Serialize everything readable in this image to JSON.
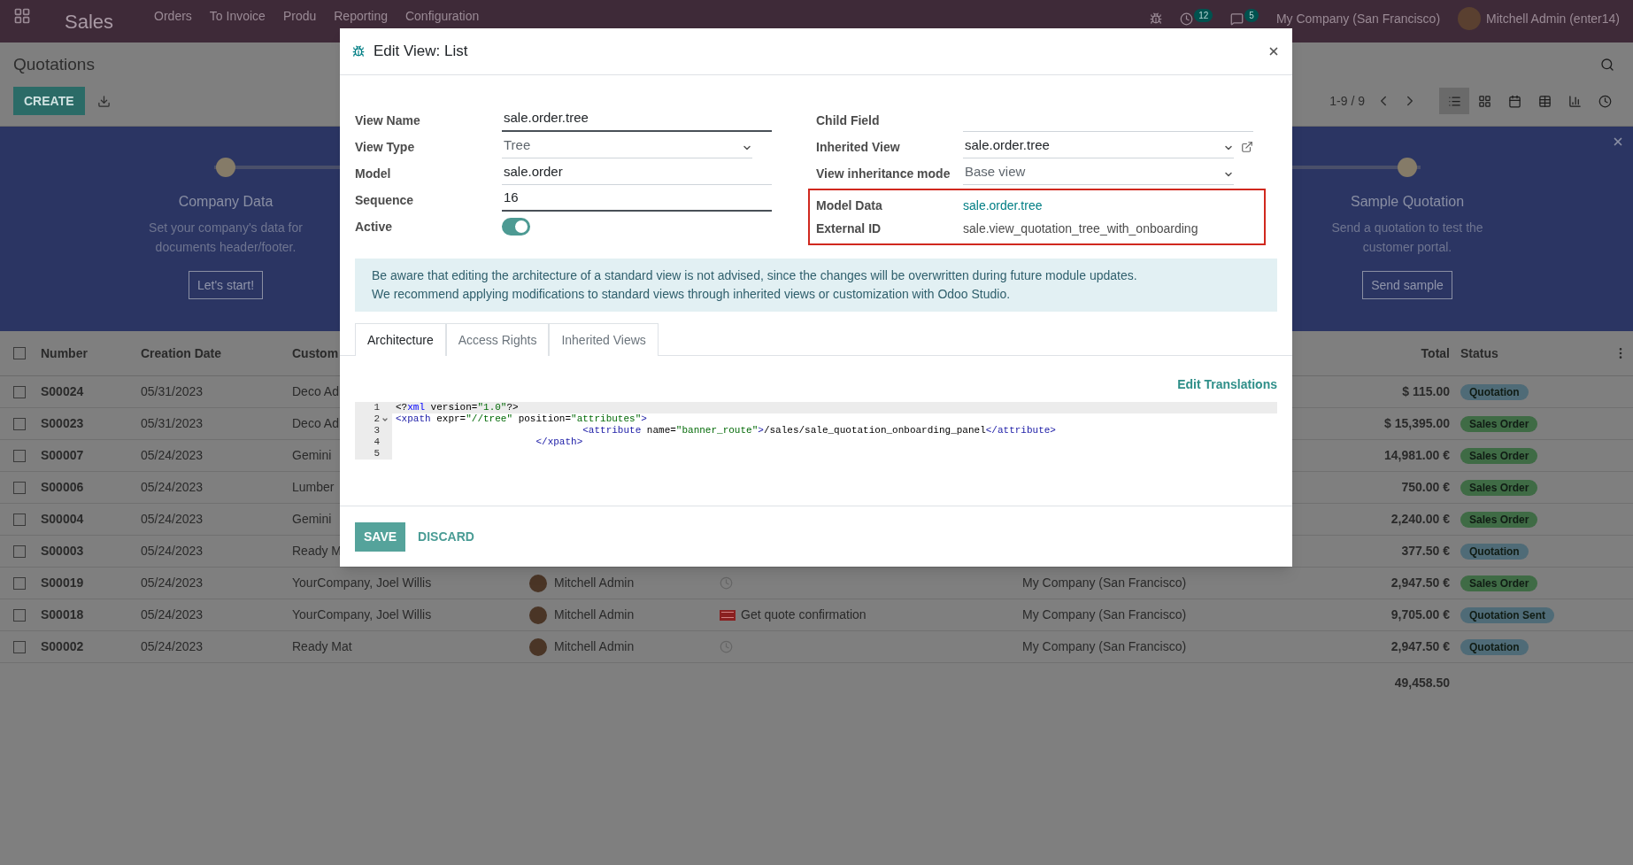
{
  "navbar": {
    "app": "Sales",
    "menu": [
      "Orders",
      "To Invoice",
      "Produ",
      "Reporting",
      "Configuration"
    ],
    "activity_count": "12",
    "message_count": "5",
    "company": "My Company (San Francisco)",
    "user": "Mitchell Admin (enter14)"
  },
  "control_panel": {
    "title": "Quotations",
    "create": "CREATE",
    "pager": "1-9 / 9",
    "views": [
      {
        "kind": "list",
        "selected": true
      },
      {
        "kind": "kanban",
        "selected": false
      },
      {
        "kind": "calendar",
        "selected": false
      },
      {
        "kind": "pivot",
        "selected": false
      },
      {
        "kind": "graph",
        "selected": false
      },
      {
        "kind": "activity",
        "selected": false
      }
    ]
  },
  "banner": {
    "steps": [
      {
        "title": "Company Data",
        "text": "Set your company's data for documents header/footer.",
        "button": "Let's start!"
      },
      {
        "title": "Sample Quotation",
        "text": "Send a quotation to test the customer portal.",
        "button": "Send sample"
      }
    ]
  },
  "table": {
    "columns": [
      "Number",
      "Creation Date",
      "Custom",
      "Total",
      "Status"
    ],
    "all_checked": false,
    "rows": [
      {
        "checked": false,
        "number": "S00024",
        "date": "05/31/2023",
        "customer": "Deco Ad",
        "total": "$ 115.00",
        "status": "Quotation",
        "color": "#4f6b77"
      },
      {
        "checked": false,
        "number": "S00023",
        "date": "05/31/2023",
        "customer": "Deco Ad",
        "total": "$ 15,395.00",
        "status": "Sales Order",
        "color": "#3f6b45"
      },
      {
        "checked": false,
        "number": "S00007",
        "date": "05/24/2023",
        "customer": "Gemini",
        "total": "14,981.00 €",
        "status": "Sales Order",
        "color": "#3f6b45"
      },
      {
        "checked": false,
        "number": "S00006",
        "date": "05/24/2023",
        "customer": "Lumber",
        "total": "750.00 €",
        "status": "Sales Order",
        "color": "#3f6b45"
      },
      {
        "checked": false,
        "number": "S00004",
        "date": "05/24/2023",
        "customer": "Gemini",
        "total": "2,240.00 €",
        "status": "Sales Order",
        "color": "#3f6b45"
      },
      {
        "checked": false,
        "number": "S00003",
        "date": "05/24/2023",
        "customer": "Ready M",
        "total": "377.50 €",
        "status": "Quotation",
        "color": "#4f6b77"
      },
      {
        "checked": false,
        "number": "S00019",
        "date": "05/24/2023",
        "customer": "YourCompany, Joel Willis",
        "salesperson": "Mitchell Admin",
        "activity": {
          "kind": "none"
        },
        "company": "My Company (San Francisco)",
        "total": "2,947.50 €",
        "status": "Sales Order",
        "color": "#3f6b45"
      },
      {
        "checked": false,
        "number": "S00018",
        "date": "05/24/2023",
        "customer": "YourCompany, Joel Willis",
        "salesperson": "Mitchell Admin",
        "activity": {
          "kind": "overdue",
          "text": "Get quote confirmation"
        },
        "company": "My Company (San Francisco)",
        "total": "9,705.00 €",
        "status": "Quotation Sent",
        "color": "#4f6b77"
      },
      {
        "checked": false,
        "number": "S00002",
        "date": "05/24/2023",
        "customer": "Ready Mat",
        "salesperson": "Mitchell Admin",
        "activity": {
          "kind": "none"
        },
        "company": "My Company (San Francisco)",
        "total": "2,947.50 €",
        "status": "Quotation",
        "color": "#4f6b77"
      }
    ],
    "sum": "49,458.50"
  },
  "dialog": {
    "title": "Edit View: List",
    "left_fields": [
      {
        "label": "View Name",
        "kind": "input",
        "value": "sale.order.tree",
        "required": true
      },
      {
        "label": "View Type",
        "kind": "select",
        "value": "Tree",
        "muted": true
      },
      {
        "label": "Model",
        "kind": "input",
        "value": "sale.order",
        "required": false
      },
      {
        "label": "Sequence",
        "kind": "input",
        "value": "16",
        "required": true
      },
      {
        "label": "Active",
        "kind": "toggle",
        "on": true
      }
    ],
    "right_fields": [
      {
        "label": "Child Field",
        "kind": "input",
        "required": false
      },
      {
        "label": "Inherited View",
        "kind": "select",
        "value": "sale.order.tree",
        "muted": false,
        "open_link": true
      },
      {
        "label": "View inheritance mode",
        "kind": "select",
        "value": "Base view",
        "muted": true
      }
    ],
    "highlighted_fields": [
      {
        "label": "Model Data",
        "kind": "link",
        "value": "sale.order.tree"
      },
      {
        "label": "External ID",
        "kind": "text",
        "value": "sale.view_quotation_tree_with_onboarding"
      }
    ],
    "alert": [
      "Be aware that editing the architecture of a standard view is not advised, since the changes will be overwritten during future module updates.",
      "We recommend applying modifications to standard views through inherited views or customization with Odoo Studio."
    ],
    "tabs": [
      {
        "label": "Architecture",
        "selected": true
      },
      {
        "label": "Access Rights",
        "selected": false
      },
      {
        "label": "Inherited Views",
        "selected": false
      }
    ],
    "edit_translations": "Edit Translations",
    "code": [
      {
        "number": "1",
        "fold": false,
        "tokens": [
          {
            "t": "<?",
            "kind": "plain"
          },
          {
            "t": "xml",
            "kind": "keyword"
          },
          {
            "t": " version=",
            "kind": "plain"
          },
          {
            "t": "\"1.0\"",
            "kind": "string"
          },
          {
            "t": "?>",
            "kind": "plain"
          }
        ]
      },
      {
        "number": "2",
        "fold": true,
        "tokens": [
          {
            "t": "<xpath",
            "kind": "tag"
          },
          {
            "t": " expr=",
            "kind": "plain"
          },
          {
            "t": "\"//tree\"",
            "kind": "string"
          },
          {
            "t": " position=",
            "kind": "plain"
          },
          {
            "t": "\"attributes\"",
            "kind": "string"
          },
          {
            "t": ">",
            "kind": "tag"
          }
        ]
      },
      {
        "number": "3",
        "fold": false,
        "tokens": [
          {
            "t": "                                <attribute",
            "kind": "tag"
          },
          {
            "t": " name=",
            "kind": "plain"
          },
          {
            "t": "\"banner_route\"",
            "kind": "string"
          },
          {
            "t": ">",
            "kind": "tag"
          },
          {
            "t": "/sales/sale_quotation_onboarding_panel",
            "kind": "plain"
          },
          {
            "t": "</attribute>",
            "kind": "tag"
          }
        ]
      },
      {
        "number": "4",
        "fold": false,
        "tokens": [
          {
            "t": "                        </xpath>",
            "kind": "tag"
          }
        ]
      },
      {
        "number": "5",
        "fold": false
      }
    ],
    "buttons": [
      {
        "label": "SAVE",
        "kind": "primary"
      },
      {
        "label": "DISCARD",
        "kind": "link"
      }
    ]
  }
}
